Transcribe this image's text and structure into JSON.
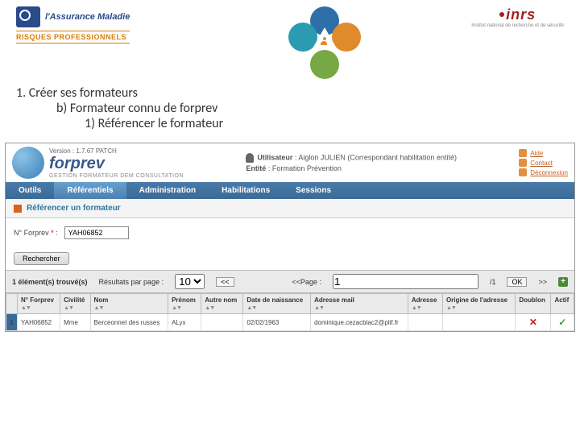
{
  "logos": {
    "assurance_maladie": "l'Assurance Maladie",
    "risques": "RISQUES PROFESSIONNELS",
    "inrs": "inrs",
    "inrs_sub": "Institut national de recherche et de sécurité"
  },
  "outline": {
    "lvl1": "1.   Créer ses formateurs",
    "lvl2": "b)   Formateur connu de forprev",
    "lvl3": "1)   Référencer le formateur"
  },
  "app": {
    "version": "Version  : 1.7.67 PATCH",
    "brand": "forprev",
    "subnav": "GESTION  FORMATEUR  DEM  CONSULTATION",
    "user_label": "Utilisateur",
    "user_value": ": Aiglon JULIEN (Correspondant habilitation entité)",
    "entity_label": "Entité",
    "entity_value": ": Formation Prévention",
    "side_links": {
      "aide": "Aide",
      "contact": "Contact",
      "deconnexion": "Déconnexion"
    }
  },
  "nav": {
    "outils": "Outils",
    "referentiels": "Référentiels",
    "administration": "Administration",
    "habilitations": "Habilitations",
    "sessions": "Sessions"
  },
  "section": {
    "title": "Référencer un formateur",
    "field_label": "N° Forprev",
    "field_value": "YAH06852",
    "search_btn": "Rechercher"
  },
  "results": {
    "count_label": "1 élément(s) trouvé(s)",
    "per_page_label": "Résultats par page :",
    "per_page_value": "10",
    "pager_prev": "<<",
    "page_label": "<<Page :",
    "page_value": "1",
    "page_total": "/1",
    "ok": "OK",
    "pager_next": ">>"
  },
  "columns": {
    "nforprev": "N° Forprev",
    "civilite": "Civilité",
    "nom": "Nom",
    "prenom": "Prénom",
    "autrenom": "Autre nom",
    "naissance": "Date de naissance",
    "mail": "Adresse mail",
    "adresse": "Adresse",
    "origine": "Origine de l'adresse",
    "doublon": "Doublon",
    "actif": "Actif"
  },
  "row": {
    "num": "1",
    "nforprev": "YAH06852",
    "civilite": "Mme",
    "nom": "Berceonnet des russes",
    "prenom": "ALyx",
    "autrenom": "",
    "naissance": "02/02/1963",
    "mail": "dominique.cezacblac2@plif.fr",
    "adresse": "",
    "origine": ""
  }
}
